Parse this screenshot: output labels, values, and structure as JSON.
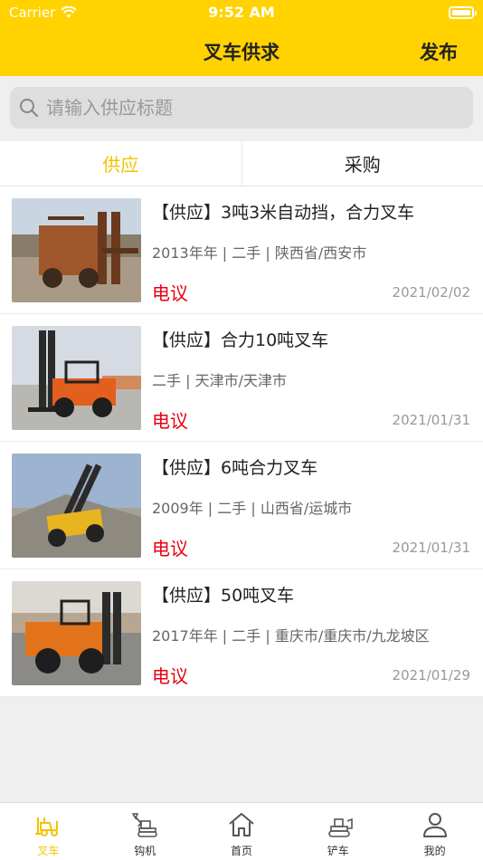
{
  "status_bar": {
    "carrier": "Carrier",
    "time": "9:52 AM"
  },
  "header": {
    "title": "叉车供求",
    "publish_label": "发布"
  },
  "search": {
    "placeholder": "请输入供应标题",
    "value": ""
  },
  "tabs": [
    {
      "label": "供应",
      "active": true
    },
    {
      "label": "采购",
      "active": false
    }
  ],
  "listings": [
    {
      "title": "【供应】3吨3米自动挡，合力叉车",
      "meta": "2013年年 | 二手 | 陕西省/西安市",
      "price": "电议",
      "date": "2021/02/02"
    },
    {
      "title": "【供应】合力10吨叉车",
      "meta": "二手 | 天津市/天津市",
      "price": "电议",
      "date": "2021/01/31"
    },
    {
      "title": "【供应】6吨合力叉车",
      "meta": "2009年 | 二手 | 山西省/运城市",
      "price": "电议",
      "date": "2021/01/31"
    },
    {
      "title": "【供应】50吨叉车",
      "meta": "2017年年 | 二手 | 重庆市/重庆市/九龙坡区",
      "price": "电议",
      "date": "2021/01/29"
    }
  ],
  "tabbar": [
    {
      "label": "叉车",
      "icon": "forklift-icon",
      "active": true
    },
    {
      "label": "钩机",
      "icon": "excavator-icon",
      "active": false
    },
    {
      "label": "首页",
      "icon": "home-icon",
      "active": false
    },
    {
      "label": "铲车",
      "icon": "loader-icon",
      "active": false
    },
    {
      "label": "我的",
      "icon": "user-icon",
      "active": false
    }
  ],
  "colors": {
    "brand": "#ffd200",
    "active_tab": "#f2c300",
    "price": "#e60012"
  }
}
